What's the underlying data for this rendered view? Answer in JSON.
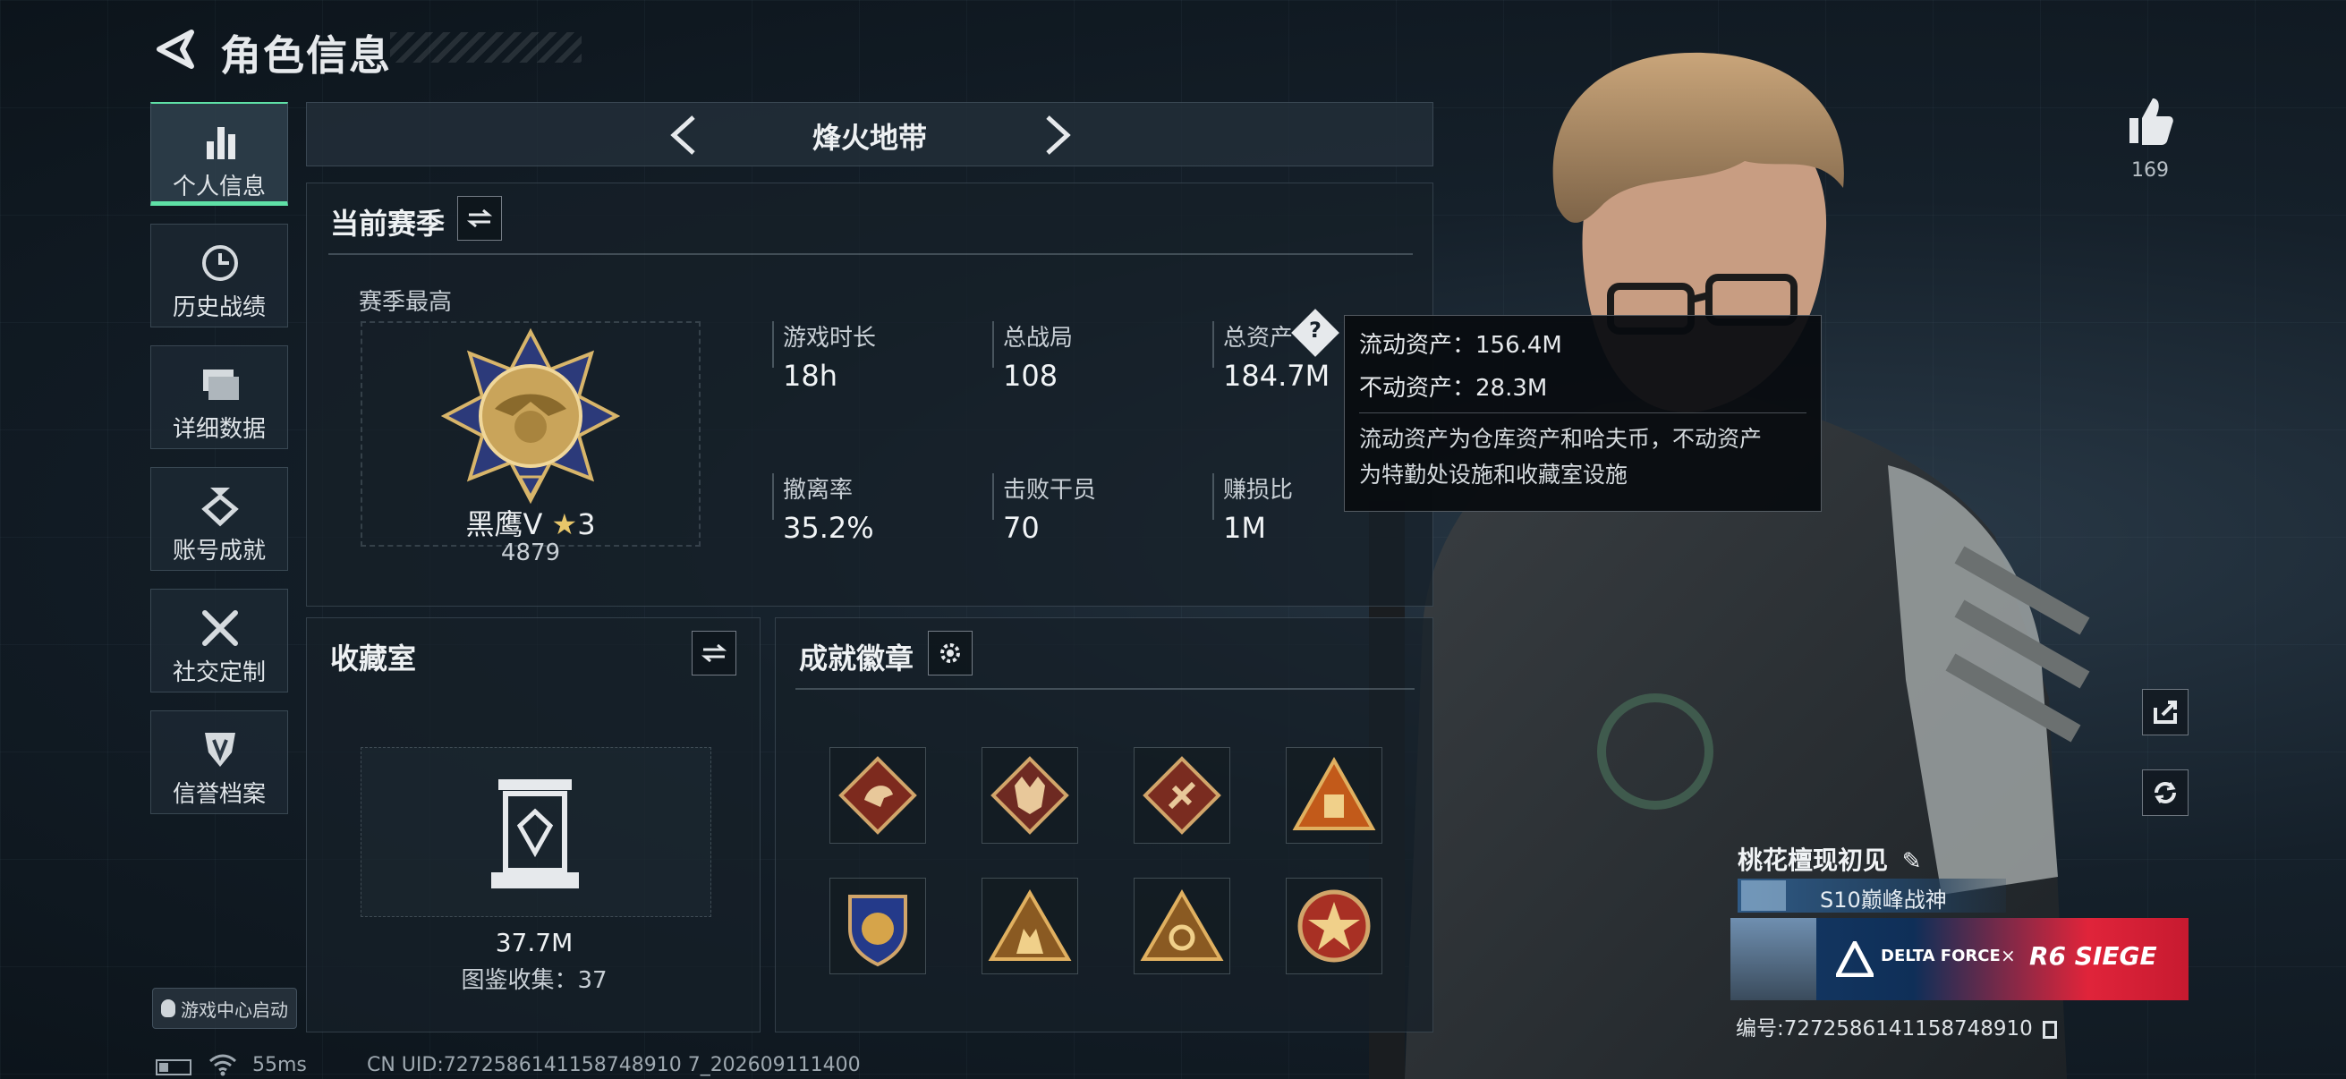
{
  "header": {
    "title": "角色信息"
  },
  "nav": {
    "items": [
      {
        "label": "个人信息",
        "icon": "bar-chart-icon",
        "active": true
      },
      {
        "label": "历史战绩",
        "icon": "history-clock-icon",
        "active": false
      },
      {
        "label": "详细数据",
        "icon": "folders-icon",
        "active": false
      },
      {
        "label": "账号成就",
        "icon": "medal-icon",
        "active": false
      },
      {
        "label": "社交定制",
        "icon": "wrench-icon",
        "active": false
      },
      {
        "label": "信誉档案",
        "icon": "shield-badge-icon",
        "active": false
      }
    ],
    "launch_label": "游戏中心启动"
  },
  "mode": {
    "name": "烽火地带"
  },
  "season": {
    "title": "当前赛季",
    "best_label": "赛季最高",
    "rank_name": "黑鹰Ⅴ",
    "rank_stars": "3",
    "rank_score": "4879",
    "stats": [
      {
        "label": "游戏时长",
        "value": "18h"
      },
      {
        "label": "总战局",
        "value": "108"
      },
      {
        "label": "总资产",
        "value": "184.7M"
      },
      {
        "label": "撤离率",
        "value": "35.2%"
      },
      {
        "label": "击败干员",
        "value": "70"
      },
      {
        "label": "赚损比",
        "value": "1M"
      }
    ]
  },
  "tooltip": {
    "liquid": "流动资产：156.4M",
    "fixed": "不动资产：28.3M",
    "desc_line1": "流动资产为仓库资产和哈夫币，不动资产",
    "desc_line2": "为特勤处设施和收藏室设施"
  },
  "collection": {
    "title": "收藏室",
    "value": "37.7M",
    "catalog": "图鉴收集：37"
  },
  "badges": {
    "title": "成就徽章",
    "items": [
      "dragon-badge-icon",
      "wolf-badge-icon",
      "dagger-badge-icon",
      "supply-badge-icon",
      "shield-crest-badge-icon",
      "squad-badge-icon",
      "eye-badge-icon",
      "star-medal-badge-icon"
    ]
  },
  "profile": {
    "likes": "169",
    "player_name": "桃花檀现初见",
    "title_badge": "S10巅峰战神",
    "banner_left": "DELTA FORCE",
    "banner_x": "×",
    "banner_right": "R6 SIEGE",
    "uid_label": "编号:7272586141158748910"
  },
  "status_bar": {
    "ping": "55ms",
    "cn_uid": "CN UID:7272586141158748910 7_202609111400"
  },
  "colors": {
    "accent": "#5fe0a6",
    "banner_red": "#e0243a",
    "panel": "#16202a"
  }
}
